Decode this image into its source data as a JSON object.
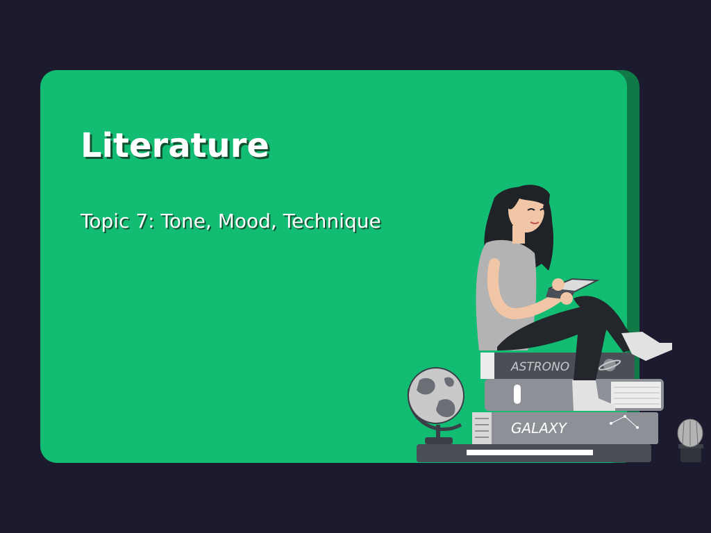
{
  "slide": {
    "title": "Literature",
    "subtitle": "Topic 7: Tone, Mood, Technique"
  },
  "illustration": {
    "book_top_label": "ASTRONO",
    "book_middle_label": "GALAXY",
    "icons": [
      "globe-icon",
      "cactus-icon",
      "planet-icon"
    ]
  },
  "colors": {
    "background": "#1b1a2e",
    "card": "#13bc73",
    "card_shadow": "#0f7a47",
    "text": "#ffffff"
  }
}
